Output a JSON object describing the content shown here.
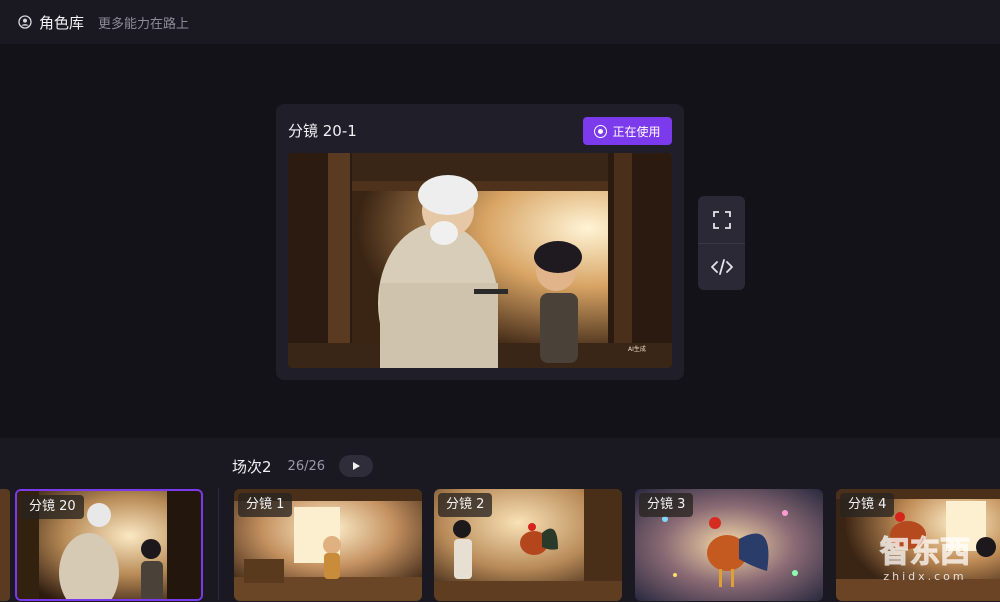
{
  "header": {
    "title": "角色库",
    "subtitle": "更多能力在路上"
  },
  "preview": {
    "title": "分镜 20-1",
    "in_use_label": "正在使用",
    "image_watermark": "AI生成"
  },
  "tools": [
    {
      "name": "fullscreen-icon"
    },
    {
      "name": "code-icon"
    }
  ],
  "scene": {
    "name": "场次2",
    "count": "26/26",
    "play_icon": "play-icon"
  },
  "thumbnails": [
    {
      "label": "分镜 20",
      "active": true
    },
    {
      "label": "分镜 1",
      "active": false
    },
    {
      "label": "分镜 2",
      "active": false
    },
    {
      "label": "分镜 3",
      "active": false
    },
    {
      "label": "分镜 4",
      "active": false
    }
  ],
  "watermark": {
    "text": "智东西",
    "domain": "zhidx.com"
  },
  "colors": {
    "accent": "#7c3aed",
    "background": "#131219",
    "panel": "#1f1e29"
  }
}
